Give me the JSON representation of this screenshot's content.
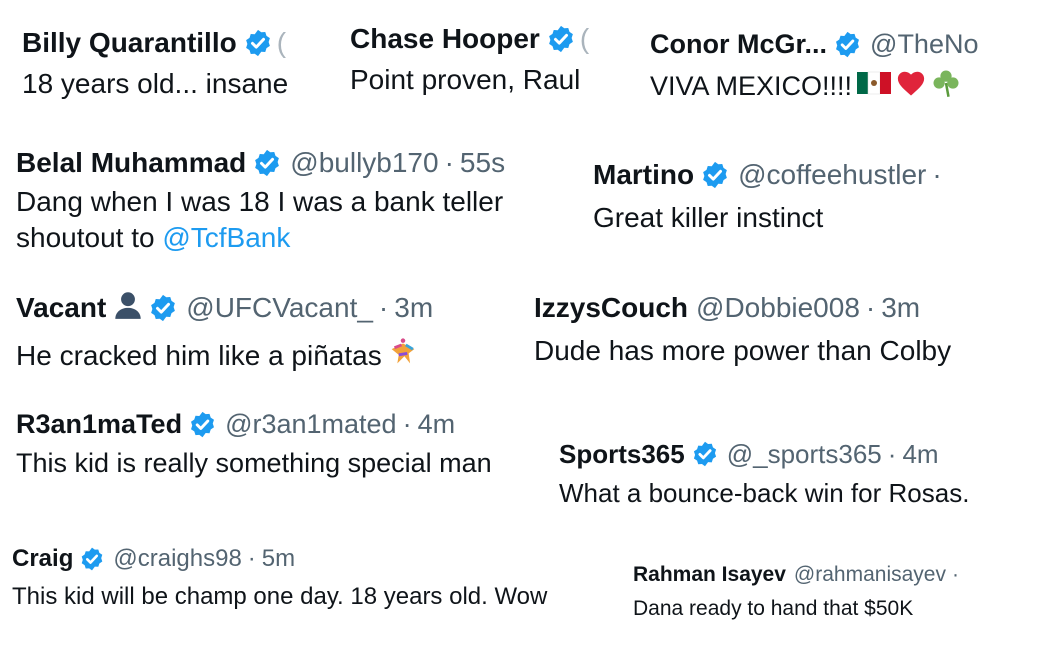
{
  "tweets": [
    {
      "name": "Billy Quarantillo",
      "handle": "",
      "time": "",
      "text": "18 years old... insane"
    },
    {
      "name": "Chase Hooper",
      "handle": "",
      "time": "",
      "text": "Point proven, Raul"
    },
    {
      "name": "Conor McGr...",
      "handle": "@TheNo",
      "time": "",
      "text": "VIVA MEXICO!!!! "
    },
    {
      "name": "Belal Muhammad",
      "handle": "@bullyb170",
      "time": "55s",
      "text": "Dang when I was 18 I was a bank teller",
      "text2": "shoutout to ",
      "mention": "@TcfBank"
    },
    {
      "name": "Martino",
      "handle": "@coffeehustler",
      "time": "",
      "text": "Great killer instinct"
    },
    {
      "name": "Vacant",
      "handle": "@UFCVacant_",
      "time": "3m",
      "text": "He cracked him like a piñatas "
    },
    {
      "name": "IzzysCouch",
      "handle": "@Dobbie008",
      "time": "3m",
      "text": "Dude has more power than Colby"
    },
    {
      "name": "R3an1maTed",
      "handle": "@r3an1mated",
      "time": "4m",
      "text": "This kid is really something special man"
    },
    {
      "name": "Sports365",
      "handle": "@_sports365",
      "time": "4m",
      "text": "What a bounce-back win for Rosas."
    },
    {
      "name": "Craig",
      "handle": "@craighs98",
      "time": "5m",
      "text": "This kid will be champ one day. 18 years old. Wow"
    },
    {
      "name": "Rahman Isayev",
      "handle": "@rahmanisayev",
      "time": "",
      "text": "Dana ready to hand that $50K"
    }
  ],
  "separator": "·",
  "colors": {
    "verified": "#1d9bf0",
    "text": "#0f1419",
    "muted": "#536471",
    "link": "#1d9bf0"
  }
}
